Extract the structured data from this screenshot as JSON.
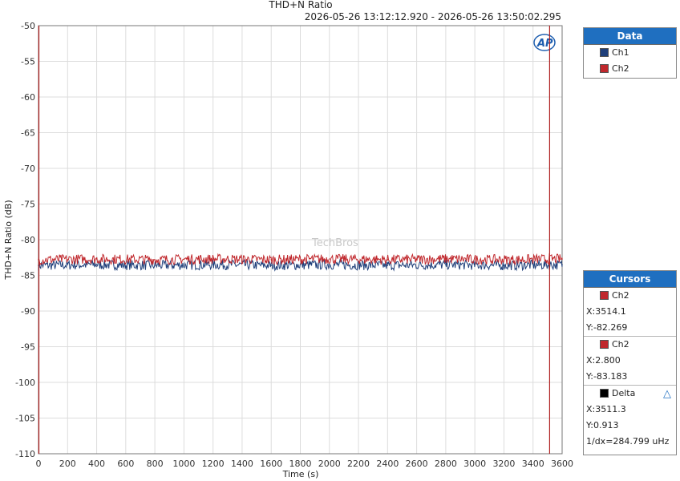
{
  "chart_data": {
    "type": "line",
    "title": "THD+N Ratio",
    "subtitle": "2026-05-26 13:12:12.920 - 2026-05-26 13:50:02.295",
    "xlabel": "Time (s)",
    "ylabel": "THD+N Ratio (dB)",
    "xlim": [
      0,
      3600
    ],
    "ylim": [
      -110,
      -50
    ],
    "xticks": [
      0,
      200,
      400,
      600,
      800,
      1000,
      1200,
      1400,
      1600,
      1800,
      2000,
      2200,
      2400,
      2600,
      2800,
      3000,
      3200,
      3400,
      3600
    ],
    "yticks": [
      -50,
      -55,
      -60,
      -65,
      -70,
      -75,
      -80,
      -85,
      -90,
      -95,
      -100,
      -105,
      -110
    ],
    "grid": true,
    "legend_position": "right",
    "series": [
      {
        "name": "Ch1",
        "color": "#1f3f7a",
        "x": [
          0,
          400,
          800,
          1200,
          1600,
          2000,
          2400,
          2800,
          3200,
          3600
        ],
        "values": [
          -83.6,
          -83.5,
          -83.6,
          -83.5,
          -83.6,
          -83.5,
          -83.6,
          -83.5,
          -83.6,
          -83.5
        ]
      },
      {
        "name": "Ch2",
        "color": "#c0282d",
        "x": [
          0,
          400,
          800,
          1200,
          1600,
          2000,
          2400,
          2800,
          3200,
          3600
        ],
        "values": [
          -82.8,
          -82.7,
          -82.8,
          -82.7,
          -82.8,
          -82.7,
          -82.8,
          -82.7,
          -82.8,
          -82.7
        ]
      }
    ],
    "cursor_lines_x": [
      2.8,
      3514.1
    ]
  },
  "legend": {
    "title": "Data",
    "items": [
      {
        "label": "Ch1",
        "color": "#1f3f7a"
      },
      {
        "label": "Ch2",
        "color": "#c0282d"
      }
    ]
  },
  "cursors": {
    "title": "Cursors",
    "cursor1": {
      "label": "Ch2",
      "color": "#c0282d",
      "x": "X:3514.1",
      "y": "Y:-82.269"
    },
    "cursor2": {
      "label": "Ch2",
      "color": "#c0282d",
      "x": "X:2.800",
      "y": "Y:-83.183"
    },
    "delta": {
      "label": "Delta",
      "color": "#000000",
      "x": "X:3511.3",
      "y": "Y:0.913",
      "inv": "1/dx=284.799 uHz"
    }
  },
  "watermark": "TechBros",
  "logo_text": "AP"
}
